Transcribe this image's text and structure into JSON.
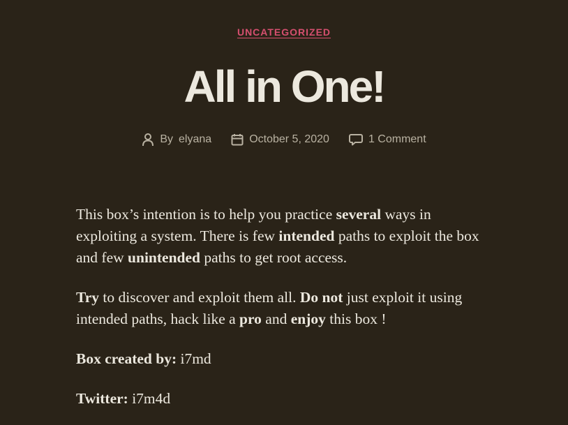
{
  "post": {
    "category": "UNCATEGORIZED",
    "title": "All in One!",
    "meta": {
      "author_prefix": "By",
      "author": "elyana",
      "date": "October 5, 2020",
      "comments": "1 Comment"
    },
    "content": {
      "p1": {
        "t1": "This box’s intention is to help you practice ",
        "b1": "several",
        "t2": " ways in exploiting a system. There is few ",
        "b2": "intended",
        "t3": " paths to exploit the box and few ",
        "b3": "unintended",
        "t4": " paths to get root access."
      },
      "p2": {
        "b1": "Try",
        "t1": " to discover and exploit them all. ",
        "b2": "Do not",
        "t2": " just exploit it using intended paths, hack like a ",
        "b3": "pro",
        "t3": " and ",
        "b4": "enjoy",
        "t4": " this box !"
      },
      "p3": {
        "label": "Box created by:",
        "value": " i7md"
      },
      "p4": {
        "label": "Twitter:",
        "value": " i7m4d"
      }
    }
  },
  "colors": {
    "background": "#2a2318",
    "accent": "#d64f6f",
    "text": "#ece8de",
    "meta": "#b9b2a2"
  },
  "icons": {
    "author": "person-icon",
    "date": "calendar-icon",
    "comments": "comment-bubble-icon"
  }
}
